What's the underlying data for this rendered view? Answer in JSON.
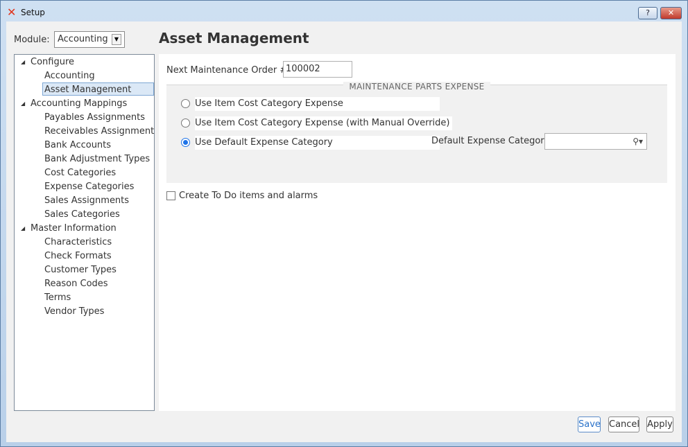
{
  "window": {
    "title": "Setup",
    "help_label": "?",
    "close_label": "✕"
  },
  "module": {
    "label": "Module:",
    "selected": "Accounting"
  },
  "tree": {
    "items": [
      {
        "label": "Configure",
        "level": 0,
        "expanded": true
      },
      {
        "label": "Accounting",
        "level": 1
      },
      {
        "label": "Asset Management",
        "level": 1,
        "selected": true
      },
      {
        "label": "Accounting Mappings",
        "level": 0,
        "expanded": true
      },
      {
        "label": "Payables Assignments",
        "level": 1
      },
      {
        "label": "Receivables Assignments",
        "level": 1
      },
      {
        "label": "Bank Accounts",
        "level": 1
      },
      {
        "label": "Bank Adjustment Types",
        "level": 1
      },
      {
        "label": "Cost Categories",
        "level": 1
      },
      {
        "label": "Expense Categories",
        "level": 1
      },
      {
        "label": "Sales Assignments",
        "level": 1
      },
      {
        "label": "Sales Categories",
        "level": 1
      },
      {
        "label": "Master Information",
        "level": 0,
        "expanded": true
      },
      {
        "label": "Characteristics",
        "level": 1
      },
      {
        "label": "Check Formats",
        "level": 1
      },
      {
        "label": "Customer Types",
        "level": 1
      },
      {
        "label": "Reason Codes",
        "level": 1
      },
      {
        "label": "Terms",
        "level": 1
      },
      {
        "label": "Vendor Types",
        "level": 1
      }
    ]
  },
  "main": {
    "title": "Asset Management",
    "next_order_label": "Next Maintenance Order #:",
    "next_order_value": "100002",
    "group_title": "MAINTENANCE PARTS EXPENSE",
    "options": [
      {
        "label": "Use Item Cost Category Expense",
        "checked": false
      },
      {
        "label": "Use Item Cost Category Expense (with Manual Override)",
        "checked": false
      },
      {
        "label": "Use Default Expense Category",
        "checked": true
      }
    ],
    "default_expense_label": "Default Expense Category:",
    "default_expense_value": "",
    "todo_label": "Create To Do items and alarms",
    "todo_checked": false
  },
  "buttons": {
    "save": "Save",
    "cancel": "Cancel",
    "apply": "Apply"
  },
  "colors": {
    "accent": "#1e73e8",
    "selection": "#dbe8f6"
  }
}
